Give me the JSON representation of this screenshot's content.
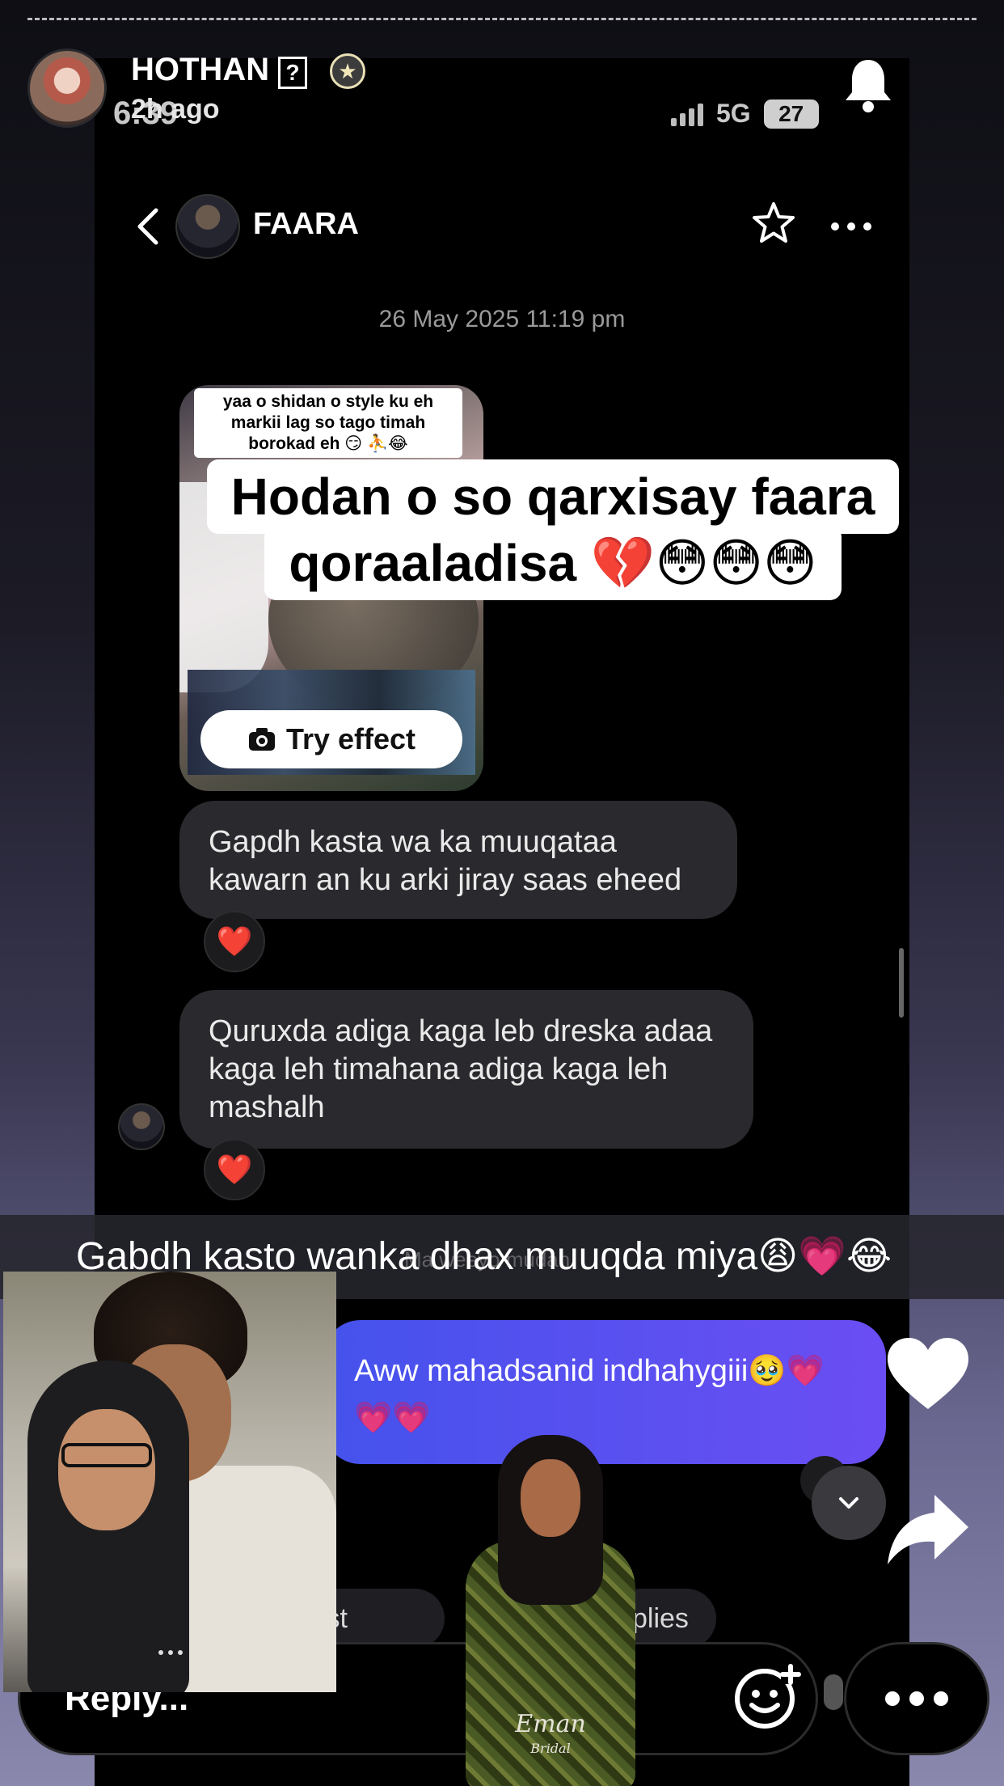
{
  "story": {
    "username": "HOTHAN",
    "question_mark": "?",
    "badge_icon": "star-badge-icon",
    "time_ago": "2h ago",
    "bell_icon": "bell-icon"
  },
  "inner_status_bar": {
    "time": "6:39",
    "network": "5G",
    "battery": "27"
  },
  "chat": {
    "contact_name": "FAARA",
    "date": "26 May 2025 11:19 pm",
    "shared_video_caption": "yaa o shidan o style ku eh markii lag so tago timah borokad eh 😏 ⛹️😂",
    "try_effect_label": "Try effect",
    "messages": [
      {
        "text": "Gapdh kasta wa ka muuqataa kawarn an ku arki jiray saas eheed",
        "reaction": "❤️"
      },
      {
        "text": "Quruxda adiga kaga leb dreska adaa kaga leh timahana adiga kaga leh mashalh",
        "reaction": "❤️"
      }
    ],
    "sent_message": "Aww mahadsanid indhahygiii🥹💗💗💗",
    "faint_text": "Ma weeyo mudan"
  },
  "overlay": {
    "title_line1": "Hodan o so qarxisay faara",
    "title_line2": "qoraaladisa 💔😳😳😳"
  },
  "banner_caption": "Gabdh kasto wanka dhax muuqda miya😩💗😂",
  "bottom": {
    "chip_left": "re post",
    "chip_right": "plies",
    "reply_placeholder": "Reply...",
    "reply_emoji": "😂"
  },
  "watermark": {
    "brand": "Eman",
    "sub": "Bridal"
  },
  "colors": {
    "sent_bubble_start": "#4552ec",
    "sent_bubble_end": "#6b4ef3",
    "received_bubble": "#2a2a2e",
    "heart_red": "#e8202e"
  }
}
